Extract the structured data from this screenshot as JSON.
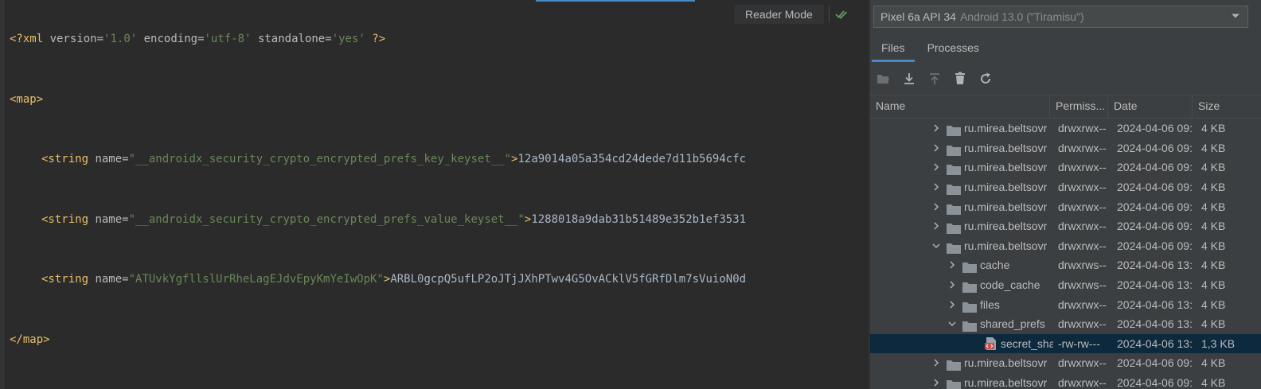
{
  "editor": {
    "line1": {
      "decl_open": "<?xml ",
      "version_attr": "version",
      "version_val": "'1.0'",
      "encoding_attr": "encoding",
      "encoding_val": "'utf-8'",
      "standalone_attr": "standalone",
      "standalone_val": "'yes'",
      "decl_close": " ?>"
    },
    "map_open": "<map>",
    "map_close": "</map>",
    "entries": [
      {
        "tag_open": "<string ",
        "attr": "name",
        "eq": "=",
        "value": "\"__androidx_security_crypto_encrypted_prefs_key_keyset__\"",
        "gt": ">",
        "text": "12a9014a05a354cd24dede7d11b5694cfc"
      },
      {
        "tag_open": "<string ",
        "attr": "name",
        "eq": "=",
        "value": "\"__androidx_security_crypto_encrypted_prefs_value_keyset__\"",
        "gt": ">",
        "text": "1288018a9dab31b51489e352b1ef3531"
      },
      {
        "tag_open": "<string ",
        "attr": "name",
        "eq": "=",
        "value": "\"ATUvkYgfllslUrRheLagEJdvEpyKmYeIwOpK\"",
        "gt": ">",
        "text": "ARBL0gcpQ5ufLP2oJTjJXhPTwv4G5OvACklV5fGRfDlm7sVuioN0d"
      }
    ],
    "reader_mode": "Reader Mode"
  },
  "device": {
    "name": "Pixel 6a API 34",
    "os": "Android 13.0 (\"Tiramisu\")"
  },
  "tabs": [
    {
      "label": "Files"
    },
    {
      "label": "Processes"
    }
  ],
  "table": {
    "headers": {
      "name": "Name",
      "perm": "Permiss...",
      "date": "Date",
      "size": "Size"
    },
    "rows": [
      {
        "name": "ru.mirea.beltsovr",
        "perm": "drwxrwx--",
        "date": "2024-04-06 09:",
        "size": "4 KB",
        "type": "folder",
        "expanded": false,
        "level": 0
      },
      {
        "name": "ru.mirea.beltsovr",
        "perm": "drwxrwx--",
        "date": "2024-04-06 09:",
        "size": "4 KB",
        "type": "folder",
        "expanded": false,
        "level": 0
      },
      {
        "name": "ru.mirea.beltsovr",
        "perm": "drwxrwx--",
        "date": "2024-04-06 09:",
        "size": "4 KB",
        "type": "folder",
        "expanded": false,
        "level": 0
      },
      {
        "name": "ru.mirea.beltsovr",
        "perm": "drwxrwx--",
        "date": "2024-04-06 09:",
        "size": "4 KB",
        "type": "folder",
        "expanded": false,
        "level": 0
      },
      {
        "name": "ru.mirea.beltsovr",
        "perm": "drwxrwx--",
        "date": "2024-04-06 09:",
        "size": "4 KB",
        "type": "folder",
        "expanded": false,
        "level": 0
      },
      {
        "name": "ru.mirea.beltsovr",
        "perm": "drwxrwx--",
        "date": "2024-04-06 09:",
        "size": "4 KB",
        "type": "folder",
        "expanded": false,
        "level": 0
      },
      {
        "name": "ru.mirea.beltsovr",
        "perm": "drwxrwx--",
        "date": "2024-04-06 09:",
        "size": "4 KB",
        "type": "folder",
        "expanded": true,
        "level": 0
      },
      {
        "name": "cache",
        "perm": "drwxrws--",
        "date": "2024-04-06 13:",
        "size": "4 KB",
        "type": "folder",
        "expanded": false,
        "level": 1
      },
      {
        "name": "code_cache",
        "perm": "drwxrws--",
        "date": "2024-04-06 13:",
        "size": "4 KB",
        "type": "folder",
        "expanded": false,
        "level": 1
      },
      {
        "name": "files",
        "perm": "drwxrwx--",
        "date": "2024-04-06 13:",
        "size": "4 KB",
        "type": "folder",
        "expanded": false,
        "level": 1
      },
      {
        "name": "shared_prefs",
        "perm": "drwxrwx--",
        "date": "2024-04-06 13:",
        "size": "4 KB",
        "type": "folder",
        "expanded": true,
        "level": 1
      },
      {
        "name": "secret_sha",
        "perm": "-rw-rw---",
        "date": "2024-04-06 13:",
        "size": "1,3 KB",
        "type": "xml-file",
        "expanded": false,
        "level": 2,
        "selected": true
      },
      {
        "name": "ru.mirea.beltsovr",
        "perm": "drwxrwx--",
        "date": "2024-04-06 09:",
        "size": "4 KB",
        "type": "folder",
        "expanded": false,
        "level": 0
      },
      {
        "name": "ru.mirea.beltsovr",
        "perm": "drwxrwx--",
        "date": "2024-04-06 09:",
        "size": "4 KB",
        "type": "folder",
        "expanded": false,
        "level": 0
      }
    ]
  },
  "colors": {
    "editor_bg": "#2b2b2b",
    "panel_bg": "#3c3f41",
    "selection": "#0d293e",
    "accent": "#4a88c7",
    "xml_tag": "#e8bf6a",
    "xml_value": "#6a8759",
    "check_green": "#5f9e5c"
  },
  "icons": {
    "reader_check": "double-check-icon",
    "device_dropdown": "chevron-down-icon",
    "toolbar": [
      "new-folder-icon",
      "download-icon",
      "upload-icon",
      "delete-icon",
      "refresh-icon"
    ]
  }
}
